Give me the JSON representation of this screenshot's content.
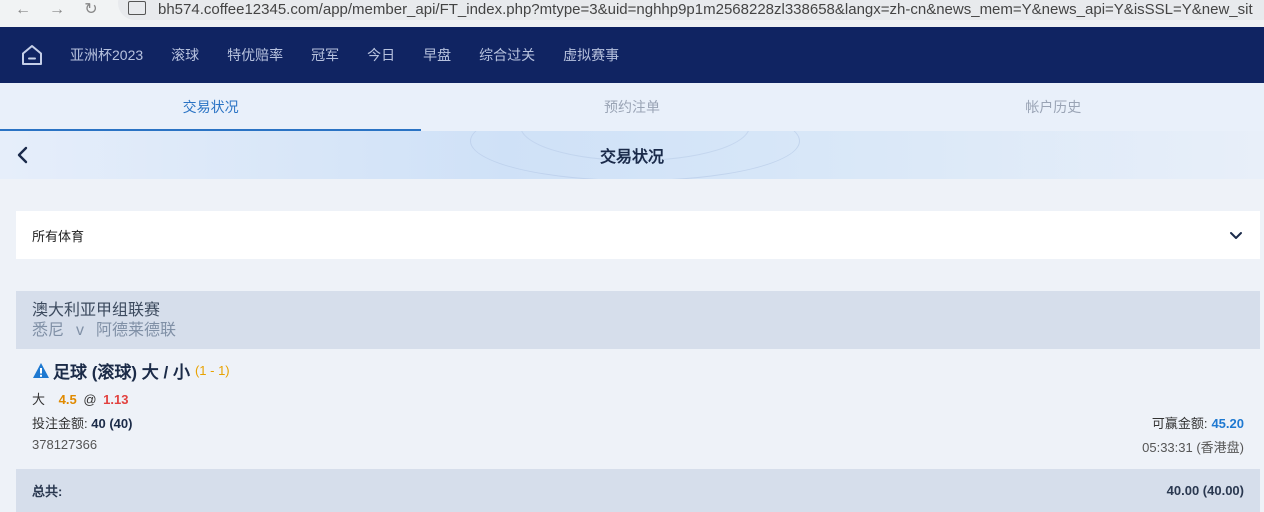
{
  "browser": {
    "url": "bh574.coffee12345.com/app/member_api/FT_index.php?mtype=3&uid=nghhp9p1m2568228zl338658&langx=zh-cn&news_mem=Y&news_api=Y&isSSL=Y&new_sit"
  },
  "top_nav": {
    "items": [
      "亚洲杯2023",
      "滚球",
      "特优赔率",
      "冠军",
      "今日",
      "早盘",
      "综合过关",
      "虚拟赛事"
    ]
  },
  "tabs": [
    {
      "label": "交易状况",
      "active": true
    },
    {
      "label": "预约注单",
      "active": false
    },
    {
      "label": "帐户历史",
      "active": false
    }
  ],
  "page": {
    "title": "交易状况"
  },
  "filter": {
    "selected": "所有体育"
  },
  "bet": {
    "league": "澳大利亚甲组联赛",
    "home_team": "悉尼",
    "vs": "v",
    "away_team": "阿德莱德联",
    "bet_type": "足球 (滚球) 大 / 小",
    "score": "(1 - 1)",
    "selection": "大",
    "line": "4.5",
    "at": "@",
    "odds": "1.13",
    "stake_label": "投注金额:",
    "stake_value": "40 (40)",
    "payout_label": "可赢金额:",
    "payout_value": "45.20",
    "ticket_id": "378127366",
    "time": "05:33:31 (香港盘)"
  },
  "total": {
    "label": "总共:",
    "value": "40.00 (40.00)"
  },
  "colors": {
    "nav_bg": "#102462",
    "accent": "#2a73c4",
    "line": "#e08a00",
    "odds": "#e2423f",
    "payout": "#1e79d1",
    "score": "#e8a200"
  }
}
